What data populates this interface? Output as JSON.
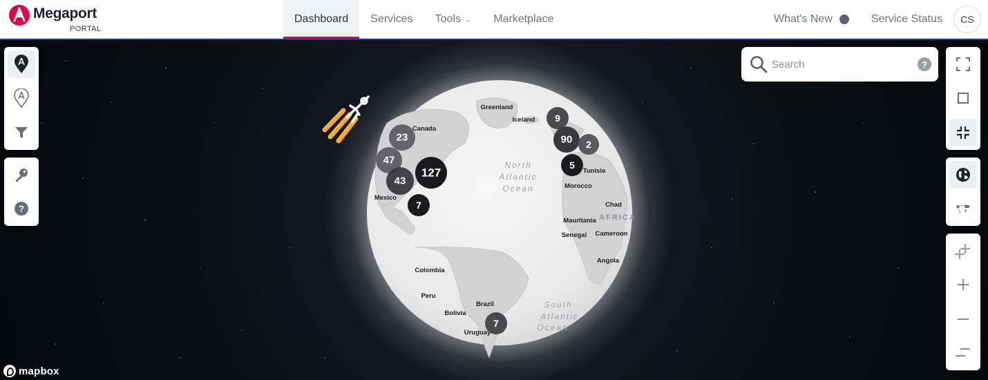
{
  "brand": {
    "name": "Megaport",
    "sub": "PORTAL",
    "color": "#e40046"
  },
  "nav": {
    "items": [
      {
        "label": "Dashboard",
        "active": true
      },
      {
        "label": "Services",
        "active": false
      },
      {
        "label": "Tools",
        "active": false,
        "dropdown": true
      },
      {
        "label": "Marketplace",
        "active": false
      }
    ]
  },
  "header": {
    "whats_new": "What's New",
    "service_status": "Service Status",
    "avatar_initials": "CS"
  },
  "search": {
    "placeholder": "Search",
    "help": "?"
  },
  "left_controls": {
    "top": [
      "megaport-locations-icon",
      "partner-locations-icon",
      "filter-icon"
    ],
    "bottom": [
      "key-icon",
      "help-icon"
    ]
  },
  "right_controls": {
    "view": [
      "fullscreen-icon",
      "square-icon",
      "collapse-icon"
    ],
    "projection": [
      "globe-icon",
      "flat-map-icon"
    ],
    "zoom": [
      "zoom-in-double-icon",
      "zoom-in-icon",
      "zoom-out-icon",
      "zoom-out-double-icon"
    ]
  },
  "map": {
    "labels": [
      "Greenland",
      "Iceland",
      "Canada",
      "Mexico",
      "Tunisia",
      "Morocco",
      "Chad",
      "Mauritania",
      "AFRICA",
      "Senegal",
      "Cameroon",
      "Angola",
      "Colombia",
      "Peru",
      "Brazil",
      "Bolivia",
      "Uruguay"
    ],
    "ocean_labels": [
      "North",
      "Atlantic",
      "Ocean",
      "South",
      "Atlantic",
      "Ocean"
    ],
    "clusters": [
      "23",
      "47",
      "127",
      "43",
      "7",
      "9",
      "90",
      "2",
      "5",
      "7"
    ]
  },
  "attribution": "mapbox"
}
